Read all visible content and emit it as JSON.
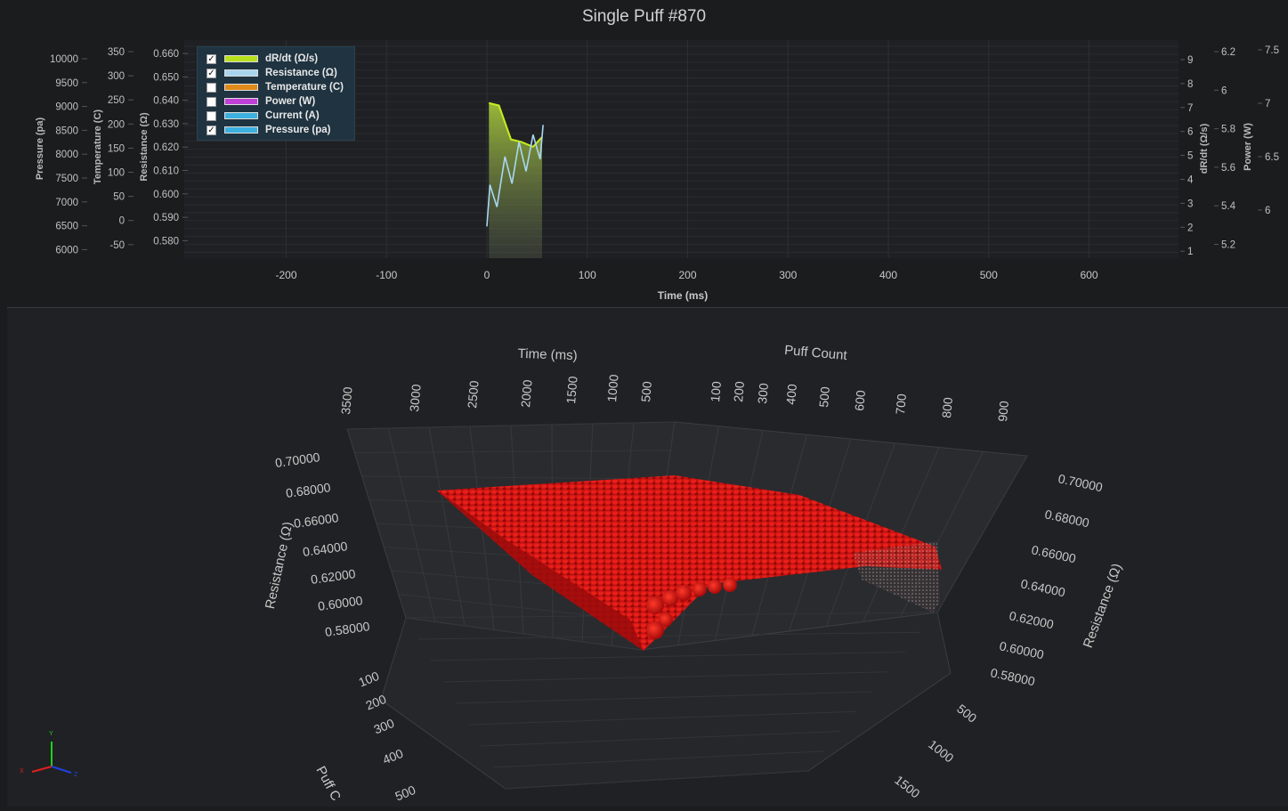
{
  "title": "Single Puff #870",
  "legend": {
    "items": [
      {
        "label": "dR/dt (Ω/s)",
        "checked": true,
        "color": "#b8e01e",
        "mark": "✓"
      },
      {
        "label": "Resistance (Ω)",
        "checked": true,
        "color": "#a8d4ee",
        "mark": "✓"
      },
      {
        "label": "Temperature (C)",
        "checked": false,
        "color": "#e08a1a",
        "mark": ""
      },
      {
        "label": "Power (W)",
        "checked": false,
        "color": "#c040d8",
        "mark": ""
      },
      {
        "label": "Current (A)",
        "checked": false,
        "color": "#3cb0e0",
        "mark": ""
      },
      {
        "label": "Pressure (pa)",
        "checked": true,
        "color": "#3cb0e0",
        "mark": "✓"
      }
    ]
  },
  "axes": {
    "pressure": {
      "label": "Pressure (pa)",
      "ticks": [
        "10000",
        "9500",
        "9000",
        "8500",
        "8000",
        "7500",
        "7000",
        "6500",
        "6000"
      ]
    },
    "temperature": {
      "label": "Temperature (C)",
      "ticks": [
        "350",
        "300",
        "250",
        "200",
        "150",
        "100",
        "50",
        "0",
        "-50"
      ]
    },
    "resistance": {
      "label": "Resistance (Ω)",
      "ticks": [
        "0.660",
        "0.650",
        "0.640",
        "0.630",
        "0.620",
        "0.610",
        "0.600",
        "0.590",
        "0.580"
      ]
    },
    "drdt": {
      "label": "dR/dt (Ω/s)",
      "ticks": [
        "9",
        "8",
        "7",
        "6",
        "5",
        "4",
        "3",
        "2",
        "1"
      ]
    },
    "power": {
      "label": "Power (W)",
      "ticks": [
        "6.2",
        "6",
        "5.8",
        "5.6",
        "5.4",
        "5.2"
      ]
    },
    "extra": {
      "ticks": [
        "7.5",
        "7",
        "6.5",
        "6"
      ]
    },
    "time": {
      "label": "Time (ms)",
      "ticks": [
        "-200",
        "-100",
        "0",
        "100",
        "200",
        "300",
        "400",
        "500",
        "600"
      ]
    }
  },
  "chart_data": [
    {
      "type": "line",
      "title": "Single Puff #870",
      "xlabel": "Time (ms)",
      "xlim": [
        -290,
        680
      ],
      "series": [
        {
          "name": "dR/dt (Ω/s)",
          "axis": "dR/dt (Ω/s)",
          "ylim": [
            0.6,
            9.6
          ],
          "x": [
            2,
            12,
            24,
            34,
            46,
            55
          ],
          "y": [
            7.0,
            6.9,
            5.5,
            5.4,
            5.2,
            5.6
          ]
        },
        {
          "name": "Resistance (Ω)",
          "axis": "Resistance (Ω)",
          "ylim": [
            0.5745,
            0.6637
          ],
          "x": [
            0,
            3,
            10,
            18,
            25,
            32,
            39,
            46,
            53,
            56
          ],
          "y": [
            0.5875,
            0.6045,
            0.5955,
            0.616,
            0.605,
            0.622,
            0.61,
            0.625,
            0.615,
            0.629
          ]
        }
      ]
    },
    {
      "type": "scatter",
      "dimension": "3d",
      "x_axis": {
        "label": "Time (ms)",
        "ticks": [
          "3500",
          "3000",
          "2500",
          "2000",
          "1500",
          "1000",
          "500"
        ]
      },
      "z_axis_top": {
        "label": "Puff Count",
        "ticks": [
          "100",
          "200",
          "300",
          "400",
          "500",
          "600",
          "700",
          "800",
          "900"
        ]
      },
      "y_axis_left": {
        "label": "Resistance (Ω)",
        "ticks": [
          "0.70000",
          "0.68000",
          "0.66000",
          "0.64000",
          "0.62000",
          "0.60000",
          "0.58000"
        ]
      },
      "y_axis_right": {
        "label": "Resistance (Ω)",
        "ticks": [
          "0.70000",
          "0.68000",
          "0.66000",
          "0.64000",
          "0.62000",
          "0.60000",
          "0.58000"
        ]
      },
      "z_axis_left": {
        "label": "Puff C",
        "ticks": [
          "100",
          "200",
          "300",
          "400",
          "500"
        ]
      },
      "x_axis_right": {
        "ticks": [
          "500",
          "1000",
          "1500"
        ]
      },
      "point_color": "#d01010",
      "orientation": {
        "x": "X",
        "y": "Y",
        "z": "Z"
      }
    }
  ]
}
